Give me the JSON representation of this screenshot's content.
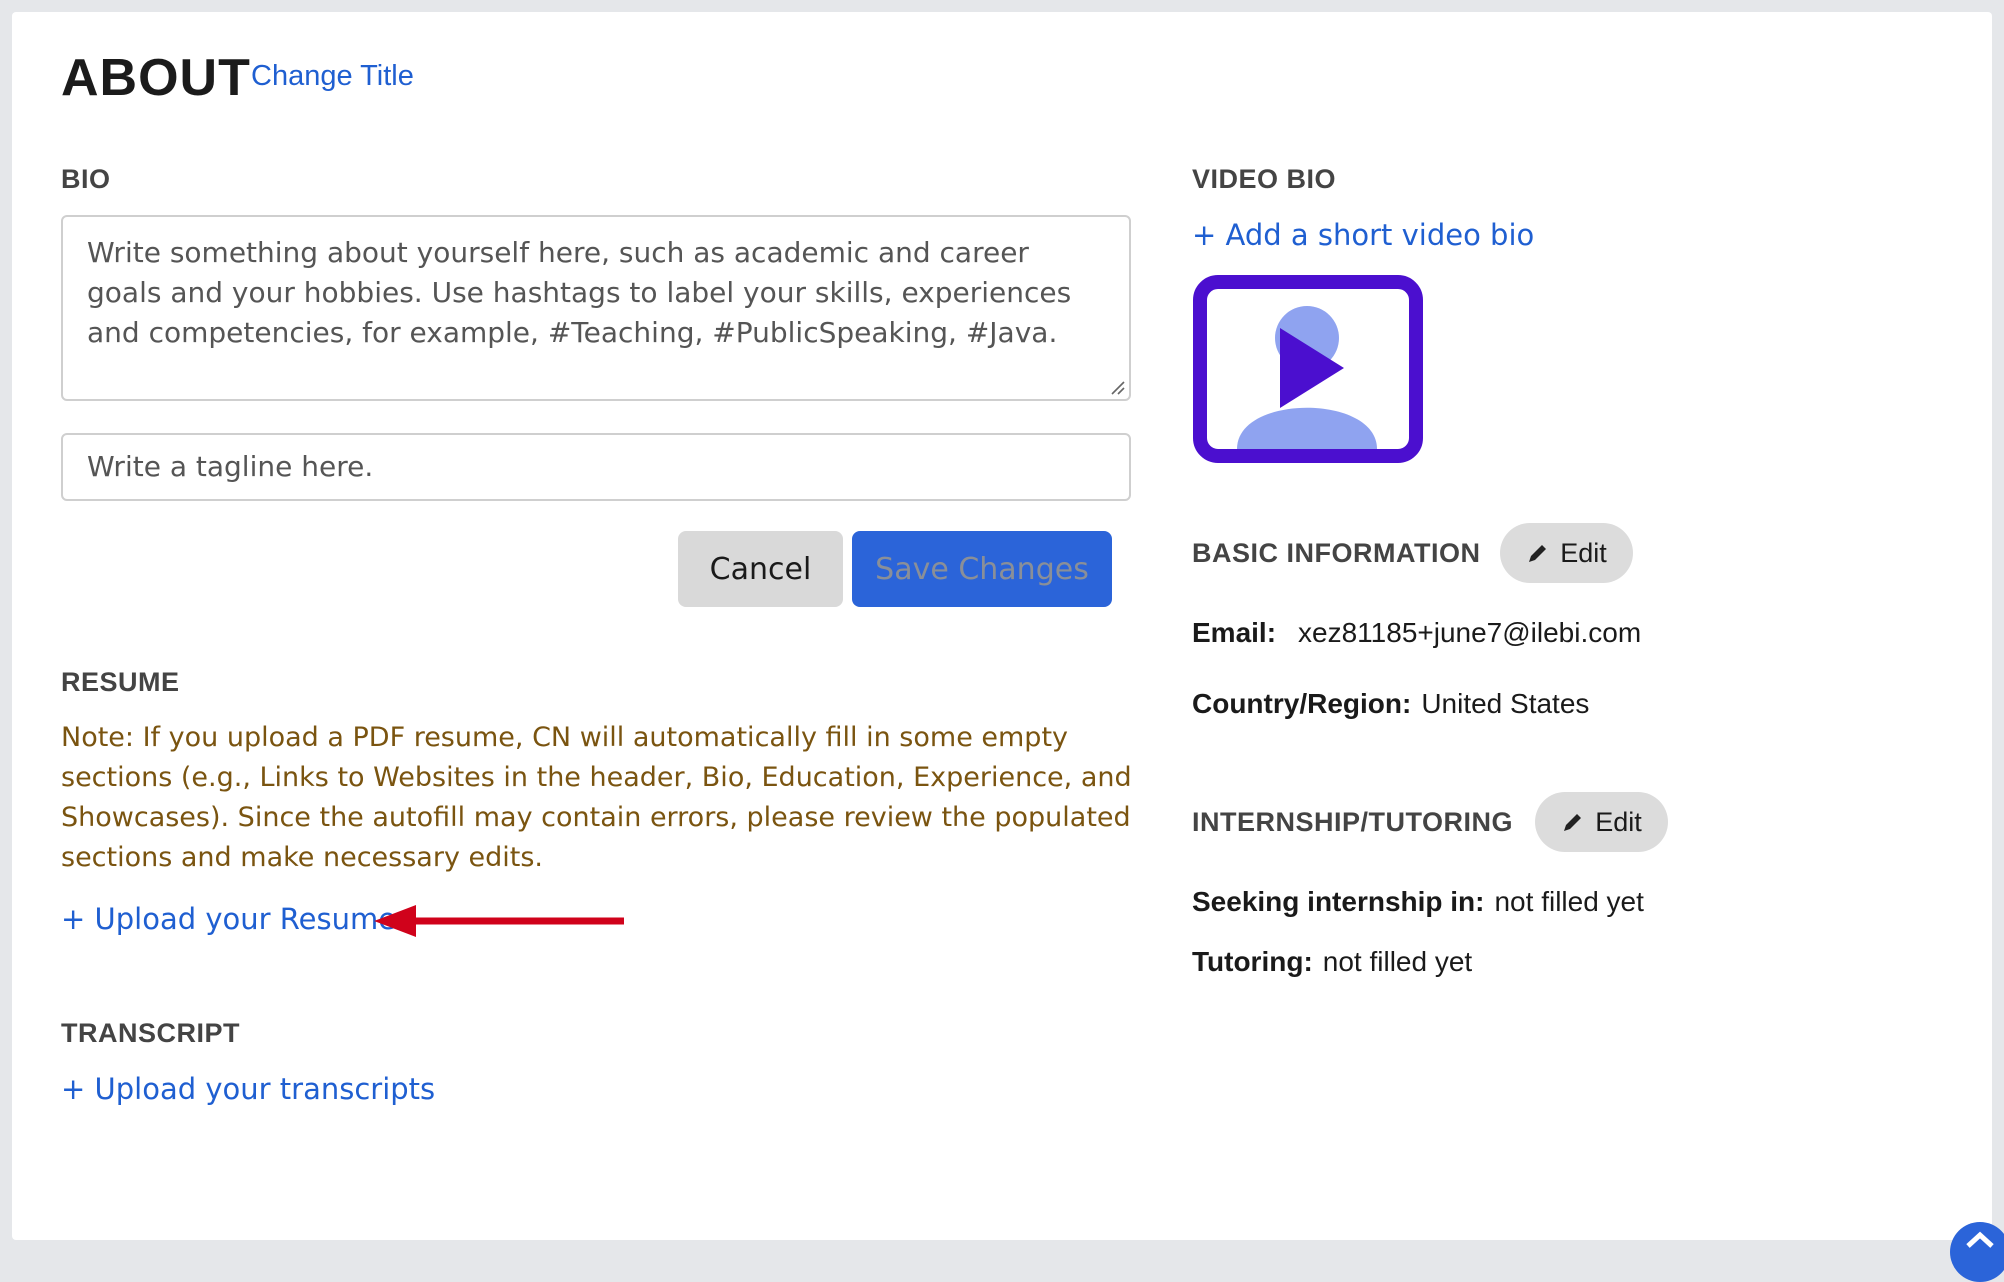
{
  "header": {
    "title": "ABOUT",
    "change_title_link": "Change Title"
  },
  "bio": {
    "heading": "BIO",
    "textarea_placeholder": "Write something about yourself here, such as academic and career goals and your hobbies. Use hashtags to label your skills, experiences and competencies, for example, #Teaching, #PublicSpeaking, #Java.",
    "tagline_placeholder": "Write a tagline here.",
    "cancel_label": "Cancel",
    "save_label": "Save Changes"
  },
  "resume": {
    "heading": "RESUME",
    "note": "Note: If you upload a PDF resume, CN will automatically fill in some empty sections (e.g., Links to Websites in the header, Bio, Education, Experience, and Showcases). Since the autofill may contain errors, please review the populated sections and make necessary edits.",
    "upload_link": "+ Upload your Resume"
  },
  "transcript": {
    "heading": "TRANSCRIPT",
    "upload_link": "+ Upload your transcripts"
  },
  "video_bio": {
    "heading": "VIDEO BIO",
    "add_link": "+ Add a short video bio"
  },
  "basic_info": {
    "heading": "BASIC INFORMATION",
    "edit_label": "Edit",
    "email_label": "Email:",
    "email_value": "xez81185+june7@ilebi.com",
    "country_label": "Country/Region:",
    "country_value": "United States"
  },
  "internship": {
    "heading": "INTERNSHIP/TUTORING",
    "edit_label": "Edit",
    "seeking_label": "Seeking internship in:",
    "seeking_value": "not filled yet",
    "tutoring_label": "Tutoring:",
    "tutoring_value": "not filled yet"
  },
  "colors": {
    "link": "#1f5fd1",
    "primary_button": "#2b64d9",
    "note_text": "#7a5410",
    "annotation_arrow": "#d0021b",
    "video_frame": "#4b0fcf",
    "video_silhouette": "#8fa3f0"
  }
}
